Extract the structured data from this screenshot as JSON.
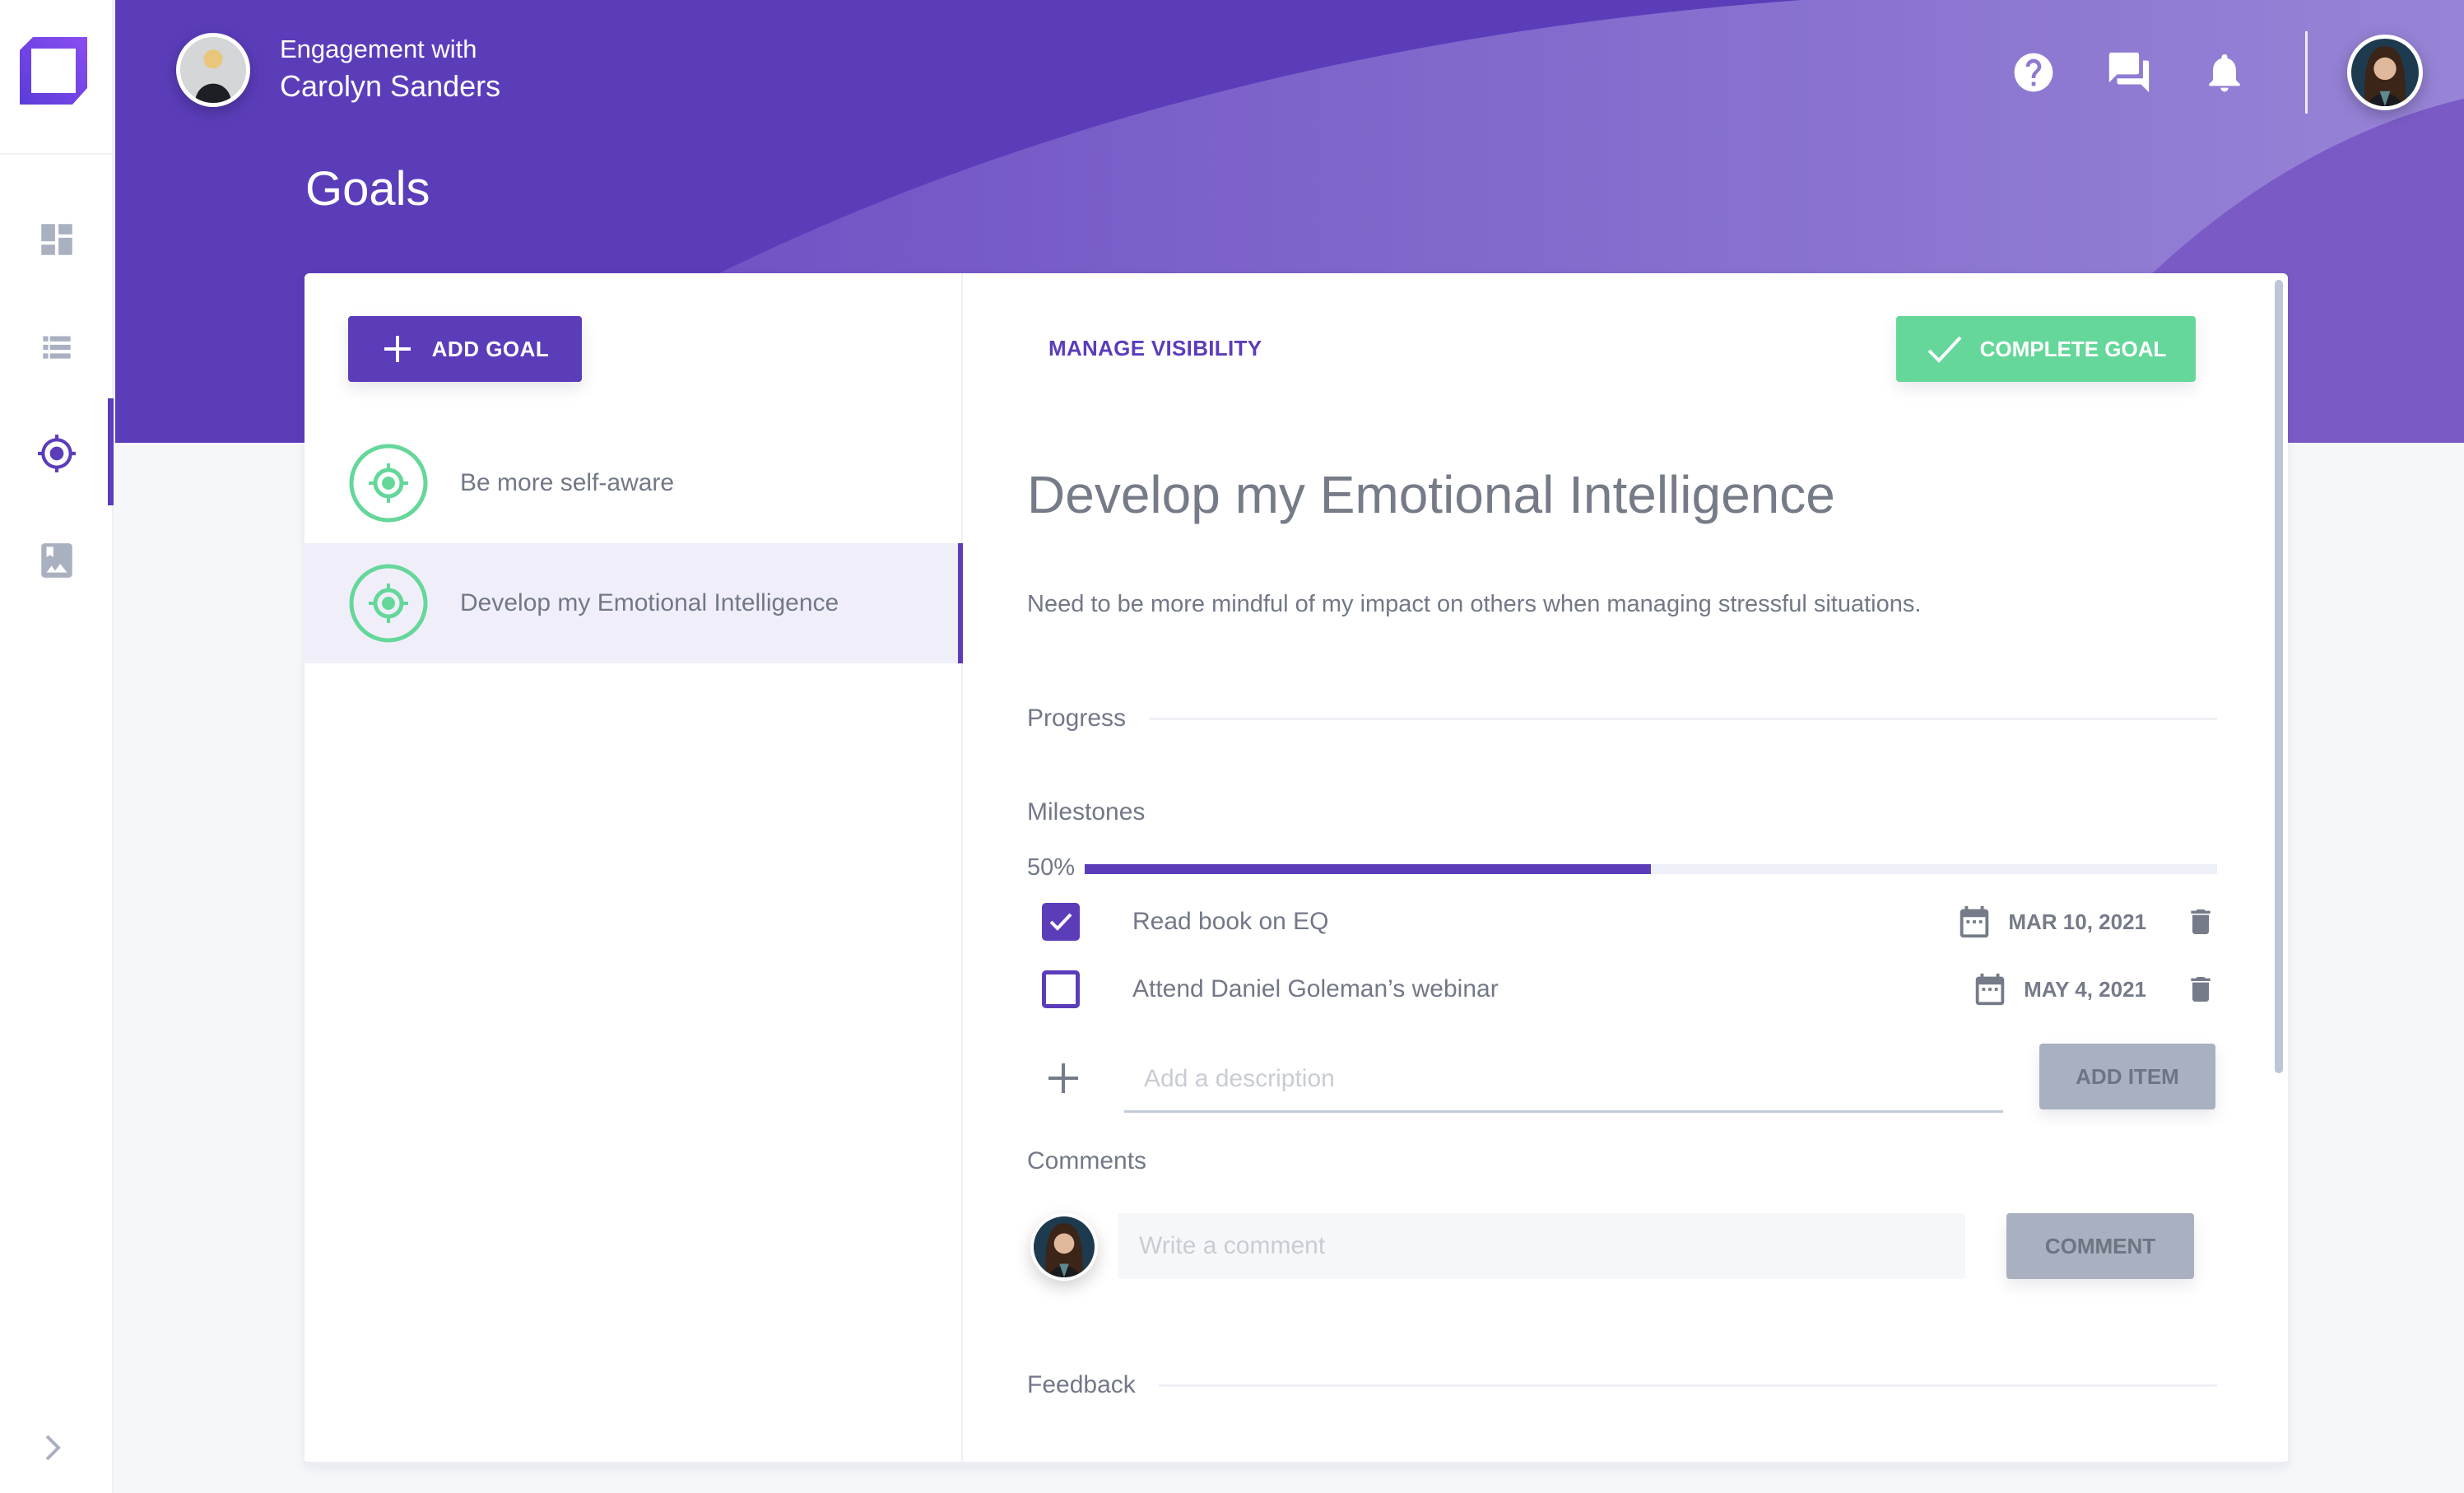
{
  "header": {
    "engagement_label": "Engagement with",
    "engagement_name": "Carolyn Sanders",
    "page_title": "Goals",
    "actions": [
      {
        "name": "help-icon"
      },
      {
        "name": "chat-icon"
      },
      {
        "name": "notifications-icon"
      }
    ]
  },
  "sidebar": {
    "items": [
      {
        "name": "dashboard-icon",
        "active": false
      },
      {
        "name": "list-icon",
        "active": false
      },
      {
        "name": "goals-target-icon",
        "active": true
      },
      {
        "name": "library-icon",
        "active": false
      }
    ],
    "expand_icon": "chevron-right-icon"
  },
  "goals_list": {
    "add_goal_label": "ADD GOAL",
    "items": [
      {
        "label": "Be more self-aware",
        "active": false
      },
      {
        "label": "Develop my Emotional Intelligence",
        "active": true
      }
    ]
  },
  "goal_detail": {
    "manage_visibility_label": "MANAGE VISIBILITY",
    "complete_goal_label": "COMPLETE GOAL",
    "title": "Develop my Emotional Intelligence",
    "description": "Need to be more mindful of my impact on others when managing stressful situations.",
    "progress_heading": "Progress",
    "milestones_heading": "Milestones",
    "progress_percent_label": "50%",
    "progress_fraction": 0.5,
    "milestones": [
      {
        "label": "Read book on EQ",
        "checked": true,
        "date": "MAR 10, 2021"
      },
      {
        "label": "Attend Daniel Goleman’s webinar",
        "checked": false,
        "date": "MAY 4, 2021"
      }
    ],
    "add_item_placeholder": "Add a description",
    "add_item_label": "ADD ITEM",
    "comments_heading": "Comments",
    "comment_placeholder": "Write a comment",
    "comment_button_label": "COMMENT",
    "feedback_heading": "Feedback"
  },
  "colors": {
    "brand_purple": "#5b3dba",
    "success_green": "#65d79a",
    "disabled_gray": "#a9b0bf"
  }
}
